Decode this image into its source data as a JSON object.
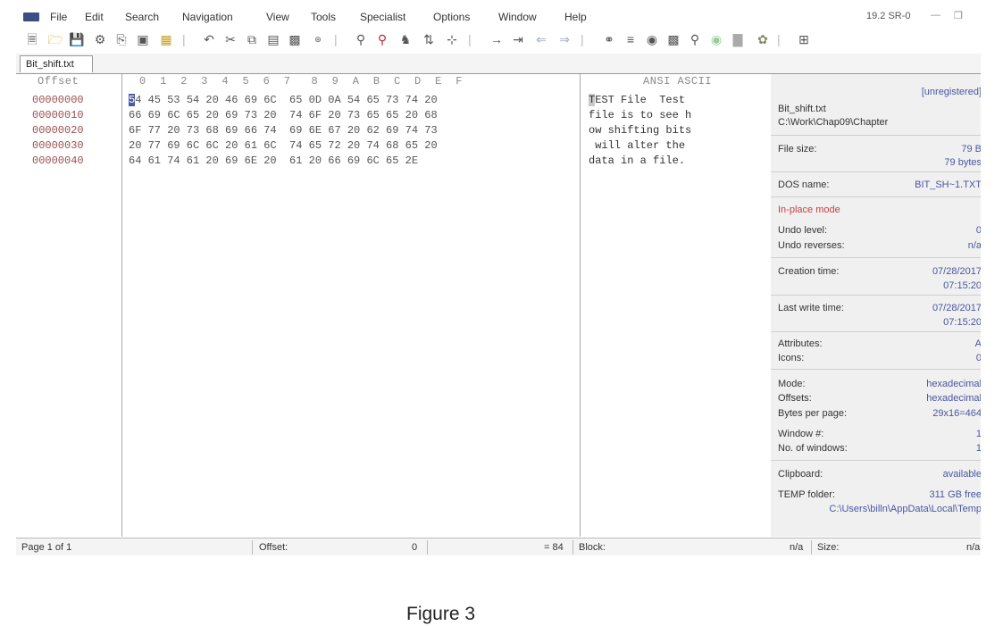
{
  "menu": {
    "items": [
      "File",
      "Edit",
      "Search",
      "Navigation",
      "View",
      "Tools",
      "Specialist",
      "Options",
      "Window",
      "Help"
    ],
    "version": "19.2 SR-0"
  },
  "tab": {
    "label": "Bit_shift.txt"
  },
  "hex": {
    "offset_header": "Offset",
    "column_header": "0  1  2  3  4  5  6  7   8  9  A  B  C  D  E  F",
    "ascii_header": "ANSI ASCII",
    "cursor_char": "5",
    "rows": [
      {
        "offset": "00000000",
        "bytes": "4 45 53 54 20 46 69 6C  65 0D 0A 54 65 73 74 20",
        "cursor_ascii": "T",
        "ascii": "EST File  Test"
      },
      {
        "offset": "00000010",
        "bytes": "66 69 6C 65 20 69 73 20  74 6F 20 73 65 65 20 68",
        "cursor_ascii": "",
        "ascii": "file is to see h"
      },
      {
        "offset": "00000020",
        "bytes": "6F 77 20 73 68 69 66 74  69 6E 67 20 62 69 74 73",
        "cursor_ascii": "",
        "ascii": "ow shifting bits"
      },
      {
        "offset": "00000030",
        "bytes": "20 77 69 6C 6C 20 61 6C  74 65 72 20 74 68 65 20",
        "cursor_ascii": "",
        "ascii": " will alter the "
      },
      {
        "offset": "00000040",
        "bytes": "64 61 74 61 20 69 6E 20  61 20 66 69 6C 65 2E",
        "cursor_ascii": "",
        "ascii": "data in a file."
      }
    ]
  },
  "info": {
    "registration": "[unregistered]",
    "file_name": "Bit_shift.txt",
    "file_path": "C:\\Work\\Chap09\\Chapter",
    "file_size_label": "File size:",
    "file_size_value": "79 B",
    "file_size_bytes": "79 bytes",
    "dos_name_label": "DOS name:",
    "dos_name_value": "BIT_SH~1.TXT",
    "mode_heading": "In-place mode",
    "undo_level_label": "Undo level:",
    "undo_level_value": "0",
    "undo_reverses_label": "Undo reverses:",
    "undo_reverses_value": "n/a",
    "creation_label": "Creation time:",
    "creation_date": "07/28/2017",
    "creation_time": "07:15:20",
    "write_label": "Last write time:",
    "write_date": "07/28/2017",
    "write_time": "07:15:20",
    "attributes_label": "Attributes:",
    "attributes_value": "A",
    "icons_label": "Icons:",
    "icons_value": "0",
    "mode_label": "Mode:",
    "mode_value": "hexadecimal",
    "offsets_label": "Offsets:",
    "offsets_value": "hexadecimal",
    "bpp_label": "Bytes per page:",
    "bpp_value": "29x16=464",
    "window_label": "Window #:",
    "window_value": "1",
    "nwin_label": "No. of windows:",
    "nwin_value": "1",
    "clipboard_label": "Clipboard:",
    "clipboard_value": "available",
    "temp_label": "TEMP folder:",
    "temp_value": "311 GB free",
    "temp_path": "C:\\Users\\billn\\AppData\\Local\\Temp"
  },
  "status": {
    "page": "Page 1 of 1",
    "offset_label": "Offset:",
    "offset_value": "0",
    "value": "= 84",
    "block_label": "Block:",
    "block_value": "n/a",
    "size_label": "Size:",
    "size_value": "n/a"
  },
  "caption": "Figure 3"
}
